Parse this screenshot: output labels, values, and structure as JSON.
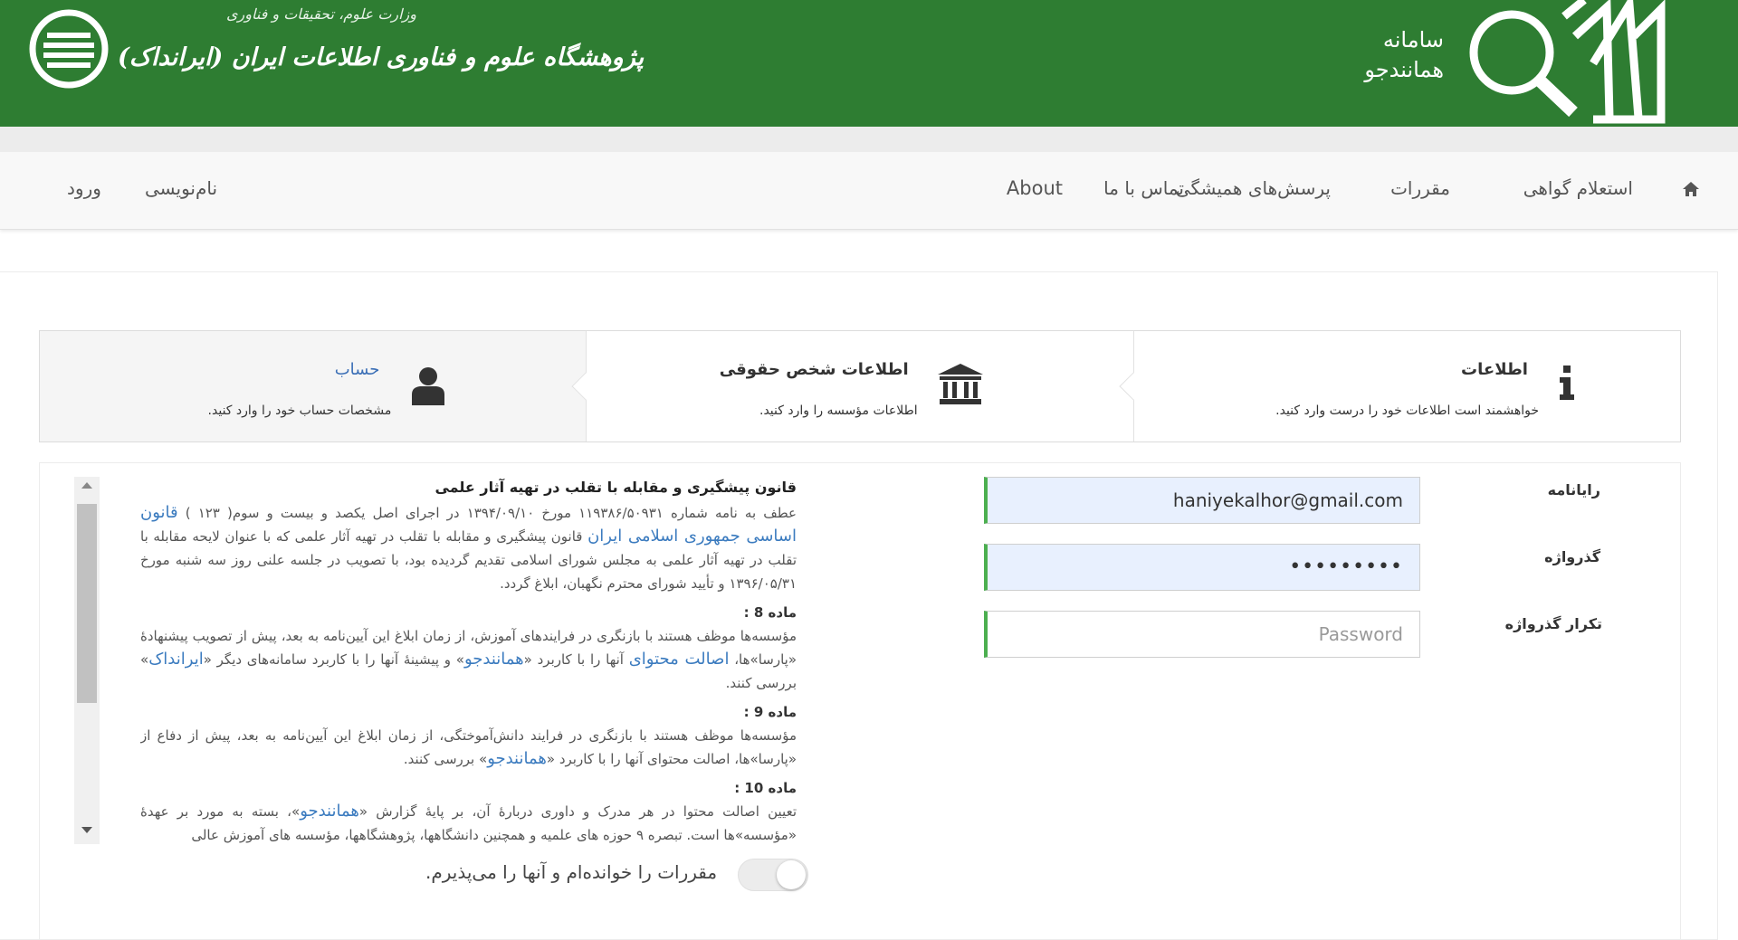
{
  "header": {
    "brand_line1": "سامانه",
    "brand_line2": "همانندجو",
    "ministry": "وزارت علوم، تحقیقات و فناوری",
    "institute": "پژوهشگاه علوم و فناوری اطلاعات ایران (ایرانداک)"
  },
  "nav": {
    "home_icon": "home-icon",
    "items": [
      "استعلام گواهی",
      "مقررات",
      "پرسش‌های همیشگی",
      "تماس با ما",
      "About"
    ],
    "login": "ورود",
    "register": "نام‌نویسی"
  },
  "steps": [
    {
      "title": "اطلاعات",
      "desc": "خواهشمند است اطلاعات خود را درست وارد کنید.",
      "icon": "info-icon",
      "active": false
    },
    {
      "title": "اطلاعات شخص حقوقی",
      "desc": "اطلاعات مؤسسه را وارد کنید.",
      "icon": "institution-icon",
      "active": false
    },
    {
      "title": "حساب",
      "desc": "مشخصات حساب خود را  وارد کنید.",
      "icon": "user-icon",
      "active": true
    }
  ],
  "form": {
    "email_label": "رایانامه",
    "email_value": "haniyekalhor@gmail.com",
    "password_label": "گذرواژه",
    "password_value": "•••••••••",
    "confirm_label": "تکرار گذرواژه",
    "confirm_placeholder": "Password"
  },
  "terms": {
    "title": "قانون پیشگیری و مقابله با تقلب در تهیه آثار علمی",
    "intro_a": "عطف به نامه شماره ۱۱۹۳۸۶/۵۰۹۳۱ مورخ ۱۳۹۴/۰۹/۱۰ در اجرای اصل یکصد و بیست و سوم( ۱۲۳ ) ",
    "intro_link": "قانون اساسی جمهوری اسلامی ایران",
    "intro_b": " قانون پیشگیری و مقابله با تقلب در تهیه آثار علمی که با عنوان لایحه مقابله با تقلب در تهیه آثار علمی به مجلس شورای اسلامی تقدیم گردیده بود، با تصویب در جلسه علنی روز سه شنبه مورخ ۱۳۹۶/۰۵/۳۱ و تأیید شورای محترم نگهبان، ابلاغ گردد.",
    "art8_title": "ماده 8 :",
    "art8_a": "مؤسسه‌ها موظف هستند با بازنگری در فرایندهای آموزش، از زمان ابلاغ این آیین‌نامه به بعد، پیش از تصویب پیشنهادهٔ «پارسا»ها، ",
    "art8_link1": "اصالت محتوای",
    "art8_b": " آنها را با کاربرد «",
    "art8_link2": "همانندجو",
    "art8_c": "» و پیشینهٔ آنها را با کاربرد سامانه‌های دیگر «",
    "art8_link3": "ایرانداک",
    "art8_d": "» بررسی کنند.",
    "art9_title": "ماده 9 :",
    "art9_a": "مؤسسه‌ها موظف هستند با بازنگری در فرایند دانش‌آموختگی، از زمان ابلاغ این آیین‌نامه به بعد، پیش از دفاع از «پارسا»ها، اصالت محتوای آنها را با کاربرد «",
    "art9_link": "همانندجو",
    "art9_b": "» بررسی کنند.",
    "art10_title": "ماده 10 :",
    "art10_a": "تعیین اصالت محتوا در هر مدرک و داوری دربارهٔ آن، بر پایهٔ گزارش «",
    "art10_link": "همانندجو",
    "art10_b": "»، بسته به مورد بر عهدهٔ «مؤسسه»ها است. تبصره ۹ حوزه های علمیه و همچنین دانشگاهها، پژوهشگاهها، مؤسسه های آموزش عالی"
  },
  "agree_text": "مقررات را خوانده‌ام و آنها را می‌پذیرم.",
  "colors": {
    "header_green": "#2e7d32",
    "field_accent": "#4caf50",
    "link_blue": "#3b7bbf"
  }
}
